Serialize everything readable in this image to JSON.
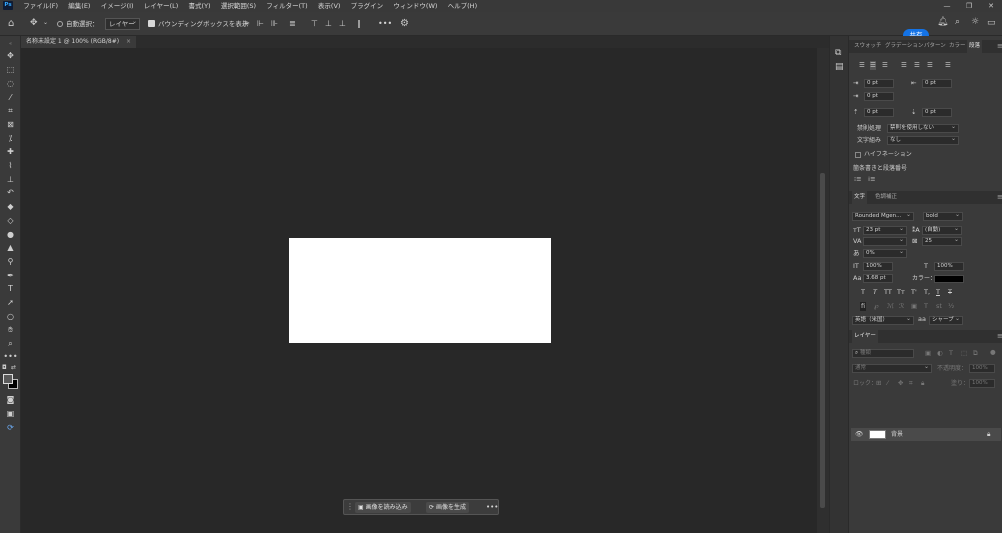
{
  "menubar": {
    "logo": "Ps",
    "items": [
      "ファイル(F)",
      "編集(E)",
      "イメージ(I)",
      "レイヤー(L)",
      "書式(Y)",
      "選択範囲(S)",
      "フィルター(T)",
      "表示(V)",
      "プラグイン",
      "ウィンドウ(W)",
      "ヘルプ(H)"
    ],
    "window_controls": [
      "—",
      "❐",
      "✕"
    ]
  },
  "options": {
    "auto_select_label": "自動選択：",
    "auto_select_target": "レイヤー",
    "bounding_box_label": "バウンディングボックスを表示",
    "more": "•••",
    "share_label": "共有"
  },
  "doc_tab": {
    "title": "名称未設定 1 @ 100% (RGB/8#)",
    "close": "×"
  },
  "context_bar": {
    "load_image": "画像を読み込み",
    "generate_image": "画像を生成",
    "more": "•••"
  },
  "panels": {
    "top_tabs": [
      "スウォッチ",
      "グラデーション",
      "パターン",
      "カラー",
      "段落"
    ],
    "paragraph": {
      "indent_left": "0 pt",
      "indent_right": "0 pt",
      "indent_first": "0 pt",
      "space_before": "0 pt",
      "space_after": "0 pt",
      "kinsoku_label": "禁則処理",
      "kinsoku_value": "禁則を使用しない",
      "mojikumi_label": "文字組み",
      "mojikumi_value": "なし",
      "hyphenation_label": "ハイフネーション",
      "bullets_label": "箇条書きと段落番号"
    },
    "char_tabs": [
      "文字",
      "色調補正"
    ],
    "character": {
      "font_family": "Rounded Mgen...",
      "font_style": "bold",
      "font_size": "23 pt",
      "leading": "(自動)",
      "kerning": "",
      "tracking": "25",
      "tsume": "0%",
      "vertical_scale": "100%",
      "horizontal_scale": "100%",
      "baseline_shift": "3.68 pt",
      "color_label": "カラー：",
      "style_buttons": [
        "T",
        "T",
        "TT",
        "Tт",
        "T'",
        "T,",
        "T",
        "T"
      ],
      "language": "英語（米国）",
      "aa_label": "aa",
      "antialias": "シャープ"
    },
    "layers_tab": "レイヤー",
    "layers": {
      "search": "種類",
      "blend_mode": "通常",
      "opacity_label": "不透明度：",
      "opacity_value": "100%",
      "lock_label": "ロック：",
      "fill_label": "塗り：",
      "fill_value": "100%",
      "layer_name": "背景"
    }
  }
}
